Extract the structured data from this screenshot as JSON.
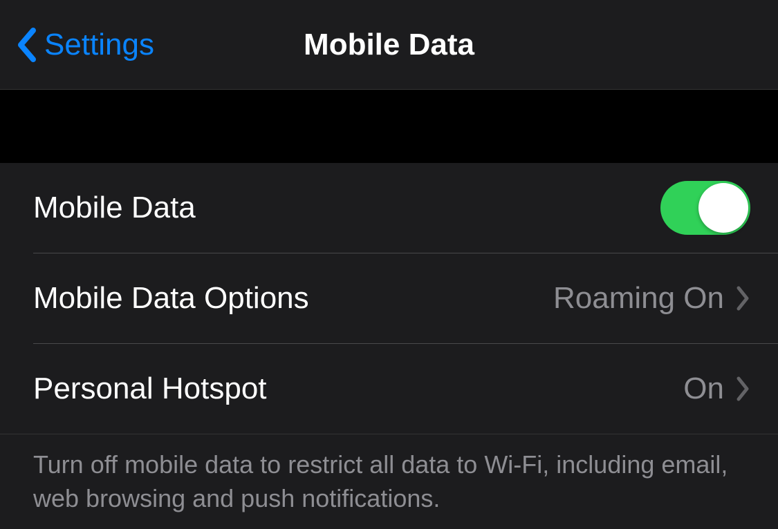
{
  "header": {
    "back_label": "Settings",
    "title": "Mobile Data"
  },
  "rows": {
    "mobile_data": {
      "label": "Mobile Data",
      "toggle_on": true
    },
    "mobile_data_options": {
      "label": "Mobile Data Options",
      "value": "Roaming On"
    },
    "personal_hotspot": {
      "label": "Personal Hotspot",
      "value": "On"
    }
  },
  "footer": {
    "text": "Turn off mobile data to restrict all data to Wi-Fi, including email, web browsing and push notifications."
  },
  "colors": {
    "accent": "#0a84ff",
    "toggle_on": "#30d158",
    "secondary_text": "#8e8e93"
  }
}
